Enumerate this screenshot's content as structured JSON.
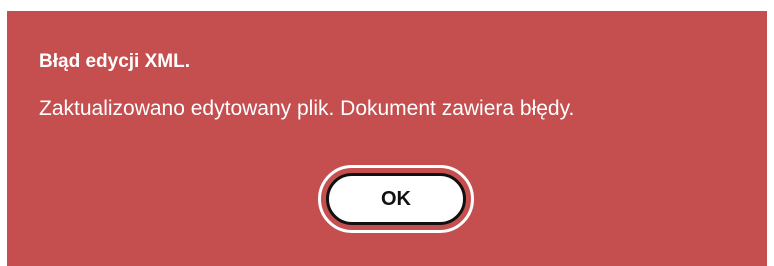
{
  "dialog": {
    "title": "Błąd edycji XML.",
    "message": "Zaktualizowano edytowany plik. Dokument zawiera błędy.",
    "ok_label": "OK",
    "background_color": "#c54e4f"
  }
}
